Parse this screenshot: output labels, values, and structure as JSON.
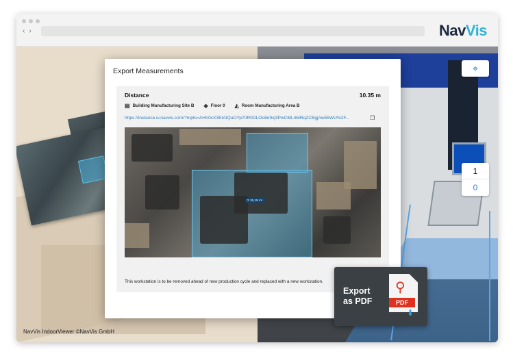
{
  "brand": {
    "logo_prefix": "Nav",
    "logo_suffix": "Vis"
  },
  "browser": {
    "back": "‹",
    "forward": "›"
  },
  "modal": {
    "title": "Export Measurements",
    "measurement": {
      "name": "Distance",
      "value": "10.35 m",
      "building": "Building Manufacturing Site B",
      "floor": "Floor 0",
      "room": "Room Manufacturing Area B",
      "link": "https://instance.iv.navvis.com/?mpts=AHtr0cX3EIAIQuOYp70R0DLOo8n9vj3PwC6tL4MRqZCBgjAw55WU%2F...",
      "area_label": "Σ 26,19 m²",
      "note": "This workstation is to be removed ahead of new production cycle and replaced with a new workstation."
    }
  },
  "map_area_label": "Σ 26,19 m²",
  "floor_picker": {
    "active": "1",
    "other": "0"
  },
  "credit": "NavVis IndoorViewer ©NavVis GmbH",
  "export_pdf": {
    "line1": "Export",
    "line2": "as PDF",
    "file_badge": "PDF"
  },
  "icons": {
    "crosshair": "⌖",
    "building": "▤",
    "floor": "◈",
    "room": "◭",
    "copy": "❐",
    "pdf_symbol": "⚲",
    "download_arrow": "⬇"
  },
  "colors": {
    "accent": "#2e86c8",
    "pdf_red": "#e0301e",
    "highlight": "#4baad7"
  }
}
